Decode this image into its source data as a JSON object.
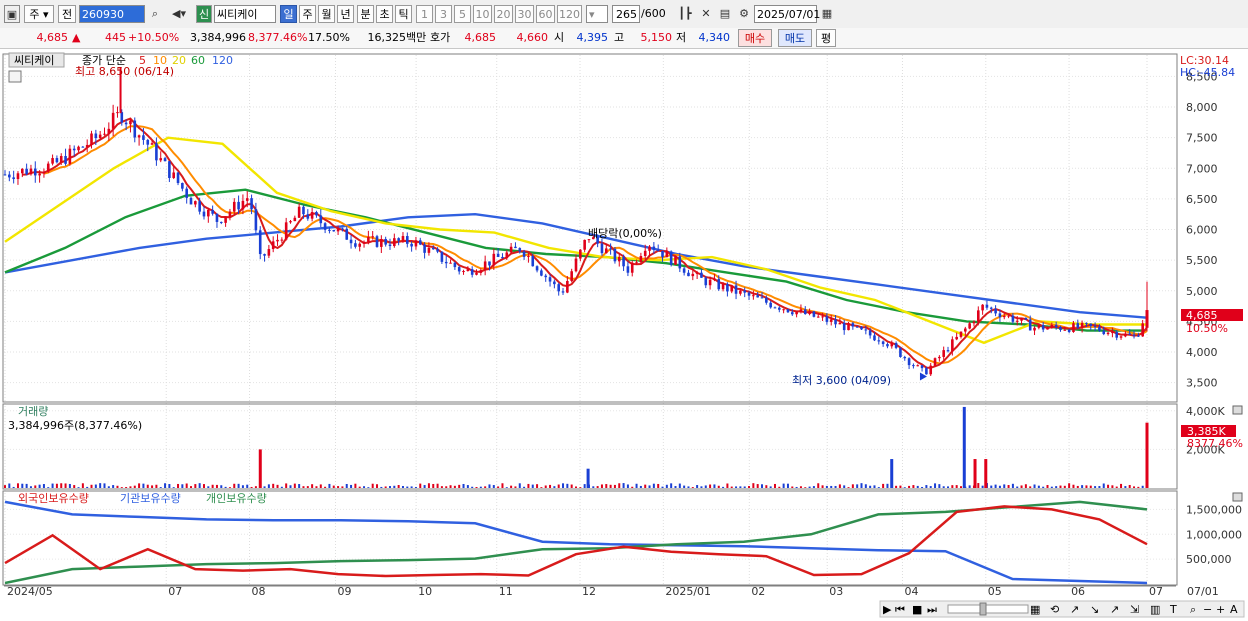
{
  "toolbar": {
    "market": "주",
    "prev_label": "전",
    "code": "260930",
    "new_label": "신",
    "name": "씨티케이",
    "periods": [
      "일",
      "주",
      "월",
      "년",
      "분",
      "초",
      "틱"
    ],
    "active_period": "일",
    "intervals": [
      "1",
      "3",
      "5",
      "10",
      "20",
      "30",
      "60",
      "120"
    ],
    "count_value": "265",
    "count_total": "/600",
    "date": "2025/07/01"
  },
  "quote": {
    "price": "4,685",
    "change": "445",
    "change_arrow": "▲",
    "change_pct": "+10.50%",
    "volume": "3,384,996",
    "volume_pct": "8,377.46%",
    "turnover_pct": "17.50%",
    "amount": "16,325",
    "amount_unit": "백만",
    "ask_label": "호가",
    "ask": "4,685",
    "bid": "4,660",
    "open_label": "시",
    "open": "4,395",
    "high_label": "고",
    "high": "5,150",
    "low_label": "저",
    "low": "4,340",
    "buy_label": "매수",
    "sell_label": "매도",
    "avg_label": "평"
  },
  "colors": {
    "up": "#e0001a",
    "down": "#1a3fd4",
    "ma5": "#d81b1b",
    "ma10": "#ff8c00",
    "ma20": "#f2e600",
    "ma60": "#1a9a3a",
    "ma120": "#3060e0",
    "foreign": "#d81b1b",
    "institution": "#3060e0",
    "individual": "#2f8f4f"
  },
  "chart_data": [
    {
      "type": "candlestick",
      "legend_name": "씨티케이",
      "legend_title": "종가 단순",
      "ma_periods": [
        5,
        10,
        20,
        60,
        120
      ],
      "lc_label": "LC:30.14",
      "hc_label": "HC:-45.84",
      "y_ticks": [
        "3,500",
        "4,000",
        "4,500",
        "5,000",
        "5,500",
        "6,000",
        "6,500",
        "7,000",
        "7,500",
        "8,000",
        "8,500"
      ],
      "ylim": [
        3200,
        8850
      ],
      "x_tick_labels": [
        "2024/05",
        "07",
        "08",
        "09",
        "10",
        "11",
        "12",
        "2025/01",
        "02",
        "03",
        "04",
        "05",
        "06",
        "07"
      ],
      "x_right_label": "07/01",
      "max_label": "최고 8,650 (06/14)",
      "min_label": "최저 3,600 (04/09)",
      "event_label": "배당락(0,00%)",
      "current_price_tag": "4,685",
      "current_pct_tag": "10.50%",
      "close_series": [
        {
          "date": "2024-05-02",
          "close": 6900
        },
        {
          "date": "2024-05-20",
          "close": 7050
        },
        {
          "date": "2024-06-05",
          "close": 7500
        },
        {
          "date": "2024-06-14",
          "close": 7900
        },
        {
          "date": "2024-06-25",
          "close": 7350
        },
        {
          "date": "2024-07-10",
          "close": 6500
        },
        {
          "date": "2024-07-20",
          "close": 6150
        },
        {
          "date": "2024-08-01",
          "close": 6550
        },
        {
          "date": "2024-08-05",
          "close": 5500
        },
        {
          "date": "2024-08-20",
          "close": 6300
        },
        {
          "date": "2024-09-10",
          "close": 5800
        },
        {
          "date": "2024-10-01",
          "close": 5800
        },
        {
          "date": "2024-10-20",
          "close": 5300
        },
        {
          "date": "2024-11-10",
          "close": 5700
        },
        {
          "date": "2024-11-25",
          "close": 4950
        },
        {
          "date": "2024-12-05",
          "close": 5900
        },
        {
          "date": "2024-12-20",
          "close": 5350
        },
        {
          "date": "2024-12-27",
          "close": 5800
        },
        {
          "date": "2025-01-15",
          "close": 5200
        },
        {
          "date": "2025-02-10",
          "close": 4800
        },
        {
          "date": "2025-03-05",
          "close": 4500
        },
        {
          "date": "2025-03-25",
          "close": 4200
        },
        {
          "date": "2025-04-09",
          "close": 3650
        },
        {
          "date": "2025-04-25",
          "close": 4400
        },
        {
          "date": "2025-05-01",
          "close": 4750
        },
        {
          "date": "2025-05-20",
          "close": 4400
        },
        {
          "date": "2025-06-10",
          "close": 4400
        },
        {
          "date": "2025-06-27",
          "close": 4240
        },
        {
          "date": "2025-07-01",
          "close": 4685
        }
      ],
      "ma_series": {
        "ma20": [
          5800,
          6400,
          7000,
          7500,
          7400,
          6600,
          6300,
          6100,
          6000,
          5950,
          5700,
          5550,
          5500,
          5550,
          5350,
          5050,
          4850,
          4500,
          4150,
          4500,
          4450,
          4450
        ],
        "ma60": [
          5300,
          5700,
          6200,
          6550,
          6650,
          6400,
          6200,
          5950,
          5700,
          5600,
          5550,
          5450,
          5300,
          5150,
          4850,
          4650,
          4500,
          4450,
          4350,
          4350
        ],
        "ma120": [
          5300,
          5500,
          5700,
          5850,
          5950,
          6050,
          6200,
          6250,
          6100,
          5850,
          5600,
          5400,
          5250,
          5100,
          4950,
          4800,
          4650,
          4560
        ]
      }
    },
    {
      "type": "bar",
      "legend_name": "거래량",
      "info_label": "3,384,996주(8,377.46%)",
      "y_ticks": [
        "2,000K",
        "4,000K"
      ],
      "current_tag": "3,385K",
      "current_pct_tag": "8377.46%",
      "ylim": [
        0,
        4300
      ],
      "unit": "K shares",
      "notable_volumes": [
        {
          "date": "2024-08-05",
          "value": 2000
        },
        {
          "date": "2024-12-05",
          "value": 1000
        },
        {
          "date": "2025-03-28",
          "value": 1500
        },
        {
          "date": "2025-04-24",
          "value": 4200
        },
        {
          "date": "2025-04-28",
          "value": 1500
        },
        {
          "date": "2025-05-02",
          "value": 1500
        },
        {
          "date": "2025-07-01",
          "value": 3385
        }
      ]
    },
    {
      "type": "line",
      "series_names": [
        "외국인보유수량",
        "기관보유수량",
        "개인보유수량"
      ],
      "y_ticks": [
        "500,000",
        "1,000,000",
        "1,500,000"
      ],
      "ylim": [
        0,
        1850000
      ],
      "foreign": [
        420000,
        980000,
        300000,
        700000,
        300000,
        270000,
        300000,
        200000,
        160000,
        180000,
        200000,
        170000,
        600000,
        750000,
        650000,
        600000,
        560000,
        180000,
        200000,
        620000,
        1450000,
        1560000,
        1500000,
        1300000,
        800000
      ],
      "institution": [
        1650000,
        1400000,
        1350000,
        1300000,
        1280000,
        1280000,
        1260000,
        1220000,
        850000,
        800000,
        780000,
        760000,
        720000,
        680000,
        660000,
        100000,
        60000,
        20000
      ],
      "individual": [
        20000,
        300000,
        350000,
        400000,
        420000,
        460000,
        480000,
        510000,
        700000,
        720000,
        800000,
        850000,
        1000000,
        1400000,
        1450000,
        1550000,
        1650000,
        1500000
      ]
    }
  ]
}
